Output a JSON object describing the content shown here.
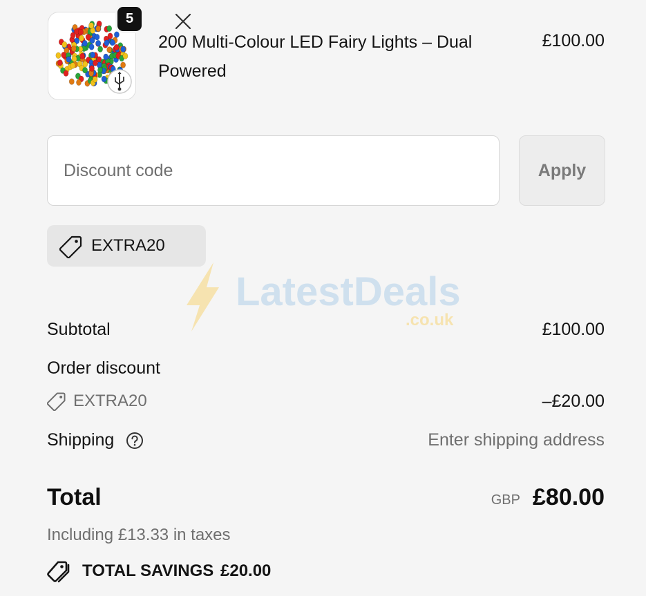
{
  "product": {
    "title": "200 Multi-Colour LED Fairy Lights – Dual Powered",
    "price": "£100.00",
    "quantity": "5",
    "image_icon": "led-fairy-lights-thumbnail",
    "sub_icon": "usb-icon"
  },
  "discount": {
    "placeholder": "Discount code",
    "apply_label": "Apply",
    "applied_code": "EXTRA20",
    "tag_icon": "tag-icon",
    "remove_icon": "close-icon"
  },
  "watermark": {
    "brand": "LatestDeals",
    "domain": ".co.uk"
  },
  "summary": {
    "subtotal_label": "Subtotal",
    "subtotal_value": "£100.00",
    "order_discount_label": "Order discount",
    "discount_code": "EXTRA20",
    "discount_value": "–£20.00",
    "shipping_label": "Shipping",
    "shipping_value": "Enter shipping address",
    "help_icon": "question-circle-icon"
  },
  "total": {
    "label": "Total",
    "currency": "GBP",
    "amount": "£80.00",
    "tax_note": "Including £13.33 in taxes",
    "savings_label": "TOTAL SAVINGS",
    "savings_amount": "£20.00",
    "savings_icon": "tags-icon"
  },
  "colors": {
    "background": "#f5f5f5",
    "text": "#141414",
    "muted_text": "#6f6f6f",
    "chip_background": "#e6e6e6",
    "badge_background": "#111111",
    "watermark_blue": "#cfe0ee",
    "watermark_yellow": "#f6e3b0"
  }
}
